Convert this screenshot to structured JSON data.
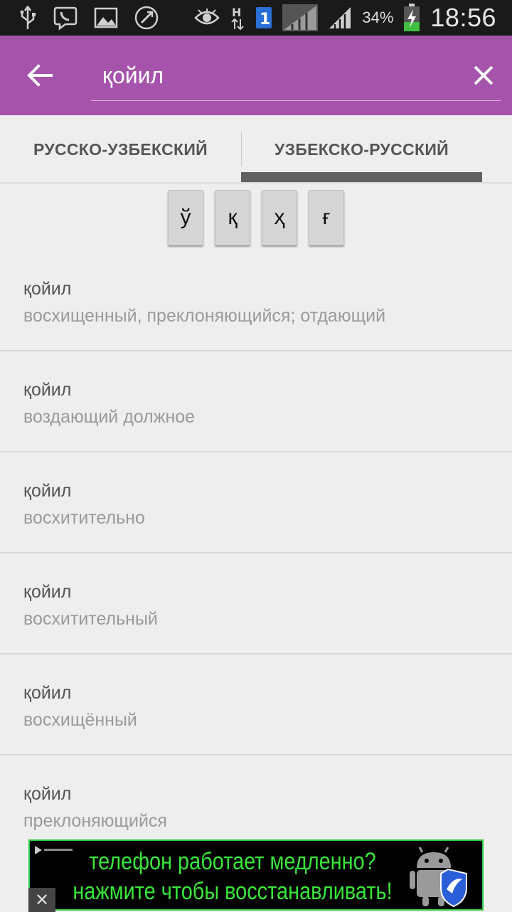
{
  "status_bar": {
    "battery_percent": "34%",
    "time": "18:56",
    "icons": [
      "usb-icon",
      "viber-icon",
      "gallery-icon",
      "phone-call-icon",
      "eye-icon",
      "network-h-icon",
      "sim1-icon",
      "signal-icon",
      "signal-icon",
      "battery-charging-icon"
    ]
  },
  "app_bar": {
    "search_value": "қойил"
  },
  "tabs": [
    {
      "label": "РУССКО-УЗБЕКСКИЙ",
      "selected": false
    },
    {
      "label": "УЗБЕКСКО-РУССКИЙ",
      "selected": true
    }
  ],
  "special_keys": [
    "ў",
    "қ",
    "ҳ",
    "ғ"
  ],
  "results": [
    {
      "word": "қойил",
      "translation": "восхищенный, преклоняющийся; отдающий"
    },
    {
      "word": "қойил",
      "translation": "воздающий должное"
    },
    {
      "word": "қойил",
      "translation": "восхитительно"
    },
    {
      "word": "қойил",
      "translation": "восхитительный"
    },
    {
      "word": "қойил",
      "translation": "восхищённый"
    },
    {
      "word": "қойил",
      "translation": "преклоняющийся"
    }
  ],
  "ad": {
    "line1": "телефон работает медленно?",
    "line2": "нажмите чтобы восстанавливать!",
    "accent_color": "#39e639"
  },
  "colors": {
    "app_bar": "#a653ab",
    "status_bar": "#1a1a1a",
    "tab_indicator": "#606060"
  }
}
